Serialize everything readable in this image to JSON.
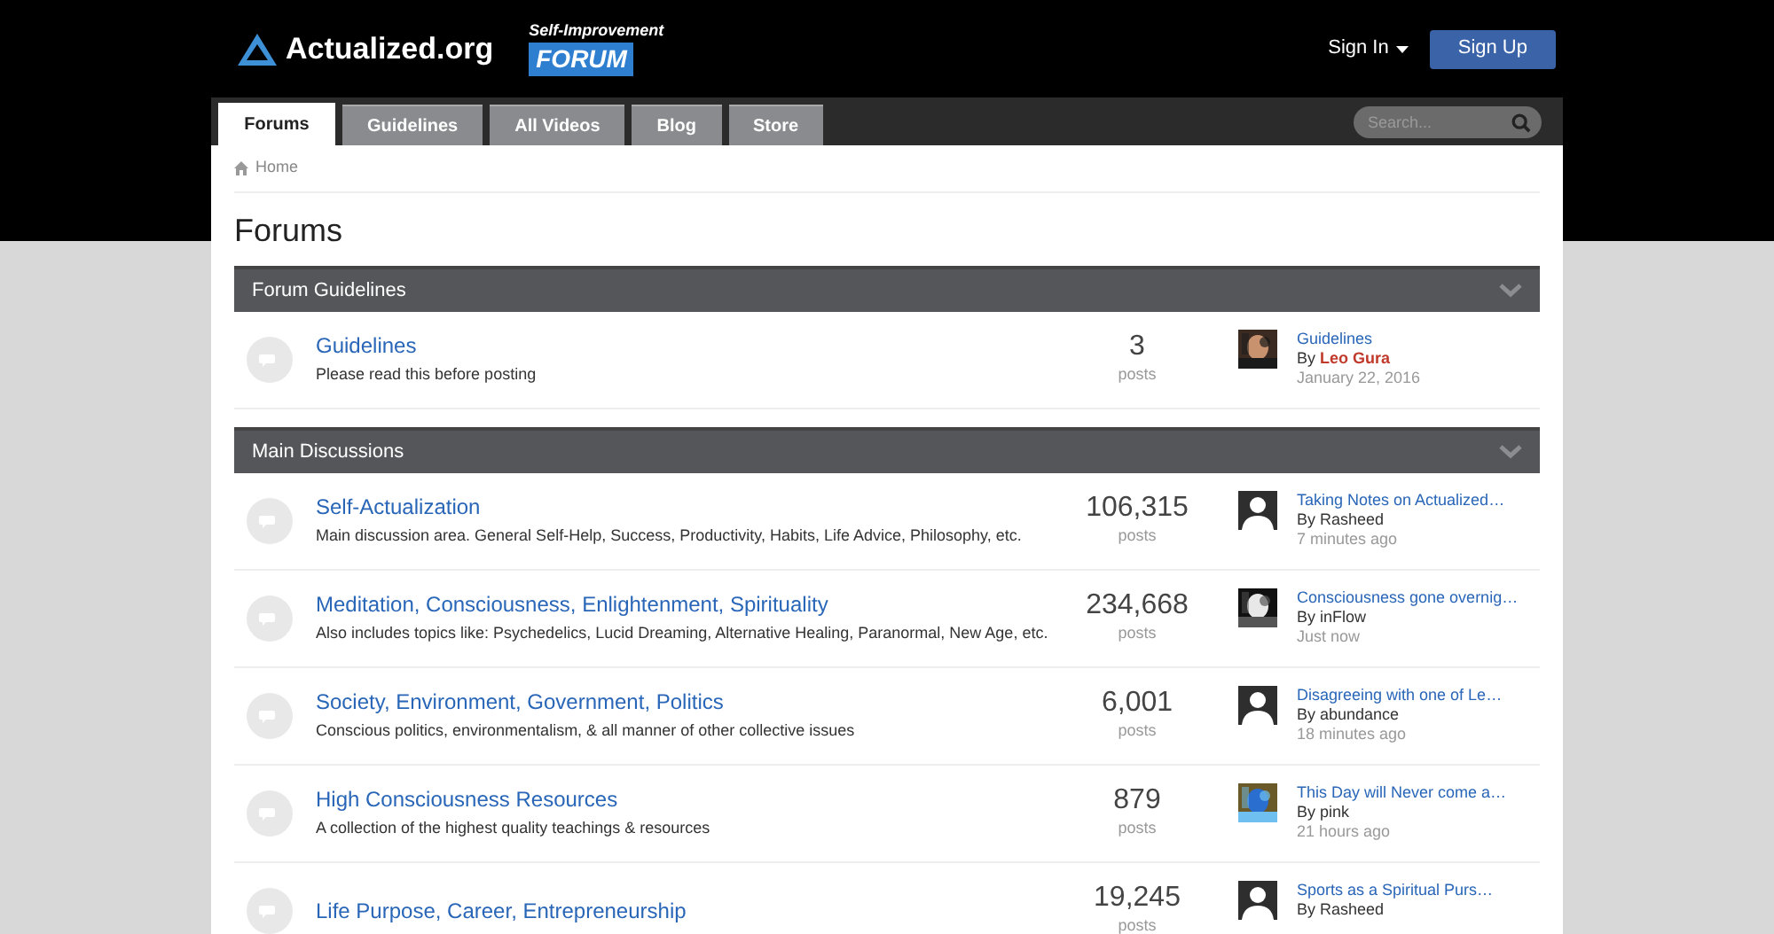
{
  "header": {
    "logo_text": "Actualized.org",
    "badge_top": "Self-Improvement",
    "badge_main": "FORUM",
    "sign_in": "Sign In",
    "sign_up": "Sign Up"
  },
  "nav": {
    "tabs": [
      {
        "label": "Forums",
        "selected": true
      },
      {
        "label": "Guidelines",
        "selected": false
      },
      {
        "label": "All Videos",
        "selected": false
      },
      {
        "label": "Blog",
        "selected": false
      },
      {
        "label": "Store",
        "selected": false
      }
    ],
    "search": {
      "placeholder": "Search..."
    }
  },
  "breadcrumb": "Home",
  "page_title": "Forums",
  "sections": [
    {
      "title": "Forum Guidelines",
      "forums": [
        {
          "name": "Guidelines",
          "description": "Please read this before posting",
          "count": "3",
          "count_label": "posts",
          "latest": {
            "title": "Guidelines",
            "by": "By",
            "author": "Leo Gura",
            "staff": true,
            "time": "January 22, 2016"
          }
        }
      ]
    },
    {
      "title": "Main Discussions",
      "forums": [
        {
          "name": "Self-Actualization",
          "description": "Main discussion area. General Self-Help, Success, Productivity, Habits, Life Advice, Philosophy, etc.",
          "count": "106,315",
          "count_label": "posts",
          "latest": {
            "title": "Taking Notes on Actualized…",
            "by": "By",
            "author": "Rasheed",
            "staff": false,
            "time": "7 minutes ago",
            "avatar": {
              "kind": "default"
            }
          }
        },
        {
          "name": "Meditation, Consciousness, Enlightenment, Spirituality",
          "description": "Also includes topics like: Psychedelics, Lucid Dreaming, Alternative Healing, Paranormal, New Age, etc.",
          "count": "234,668",
          "count_label": "posts",
          "latest": {
            "title": "Consciousness gone overnig…",
            "by": "By",
            "author": "inFlow",
            "staff": false,
            "time": "Just now"
          }
        },
        {
          "name": "Society, Environment, Government, Politics",
          "description": "Conscious politics, environmentalism, & all manner of other collective issues",
          "count": "6,001",
          "count_label": "posts",
          "latest": {
            "title": "Disagreeing with one of Le…",
            "by": "By",
            "author": "abundance",
            "staff": false,
            "time": "18 minutes ago",
            "avatar": {
              "kind": "default"
            }
          }
        },
        {
          "name": "High Consciousness Resources",
          "description": "A collection of the highest quality teachings & resources",
          "count": "879",
          "count_label": "posts",
          "latest": {
            "title": "This Day will Never come a…",
            "by": "By",
            "author": "pink",
            "staff": false,
            "time": "21 hours ago"
          }
        },
        {
          "name": "Life Purpose, Career, Entrepreneurship",
          "count": "19,245",
          "count_label": "posts",
          "latest": {
            "title": "Sports as a Spiritual Purs…",
            "by": "By",
            "author": "Rasheed",
            "staff": false,
            "avatar": {
              "kind": "default"
            }
          }
        }
      ]
    }
  ]
}
